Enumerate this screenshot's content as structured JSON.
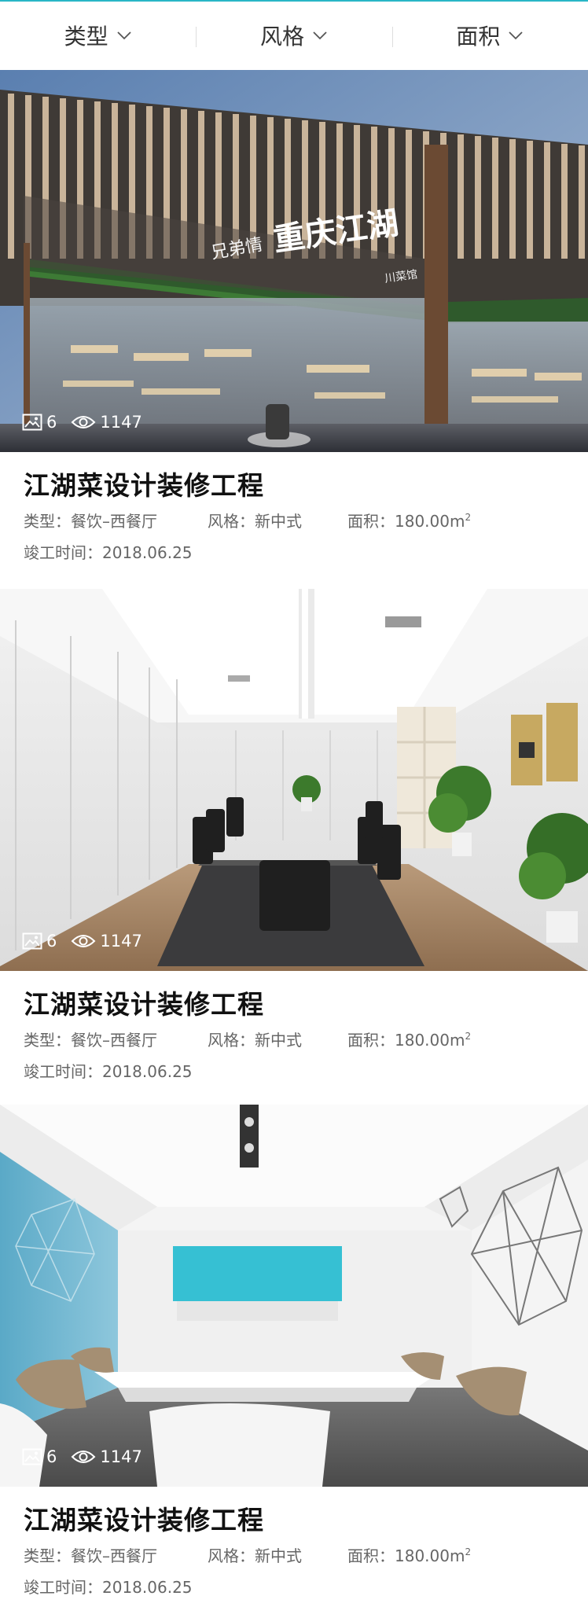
{
  "filters": [
    {
      "label": "类型"
    },
    {
      "label": "风格"
    },
    {
      "label": "面积"
    }
  ],
  "cards": [
    {
      "title": "江湖菜设计装修工程",
      "photo_count": "6",
      "view_count": "1147",
      "type_label": "类型：",
      "type_value": "餐饮–西餐厅",
      "style_label": "风格：",
      "style_value": "新中式",
      "area_label": "面积：",
      "area_value": "180.00m",
      "area_sup": "2",
      "date_label": "竣工时间：",
      "date_value": "2018.06.25"
    },
    {
      "title": "江湖菜设计装修工程",
      "photo_count": "6",
      "view_count": "1147",
      "type_label": "类型：",
      "type_value": "餐饮–西餐厅",
      "style_label": "风格：",
      "style_value": "新中式",
      "area_label": "面积：",
      "area_value": "180.00m",
      "area_sup": "2",
      "date_label": "竣工时间：",
      "date_value": "2018.06.25"
    },
    {
      "title": "江湖菜设计装修工程",
      "photo_count": "6",
      "view_count": "1147",
      "type_label": "类型：",
      "type_value": "餐饮–西餐厅",
      "style_label": "风格：",
      "style_value": "新中式",
      "area_label": "面积：",
      "area_value": "180.00m",
      "area_sup": "2",
      "date_label": "竣工时间：",
      "date_value": "2018.06.25"
    }
  ],
  "theme": {
    "accent": "#29b6c6",
    "title_color": "#111111",
    "meta_color": "#666666"
  },
  "icons": {
    "photo": "image-icon",
    "views": "eye-icon",
    "dropdown": "chevron-down-icon"
  },
  "restaurant_sign": {
    "small_left": "兄弟情",
    "main": "重庆江湖",
    "small_right": "川菜馆"
  }
}
